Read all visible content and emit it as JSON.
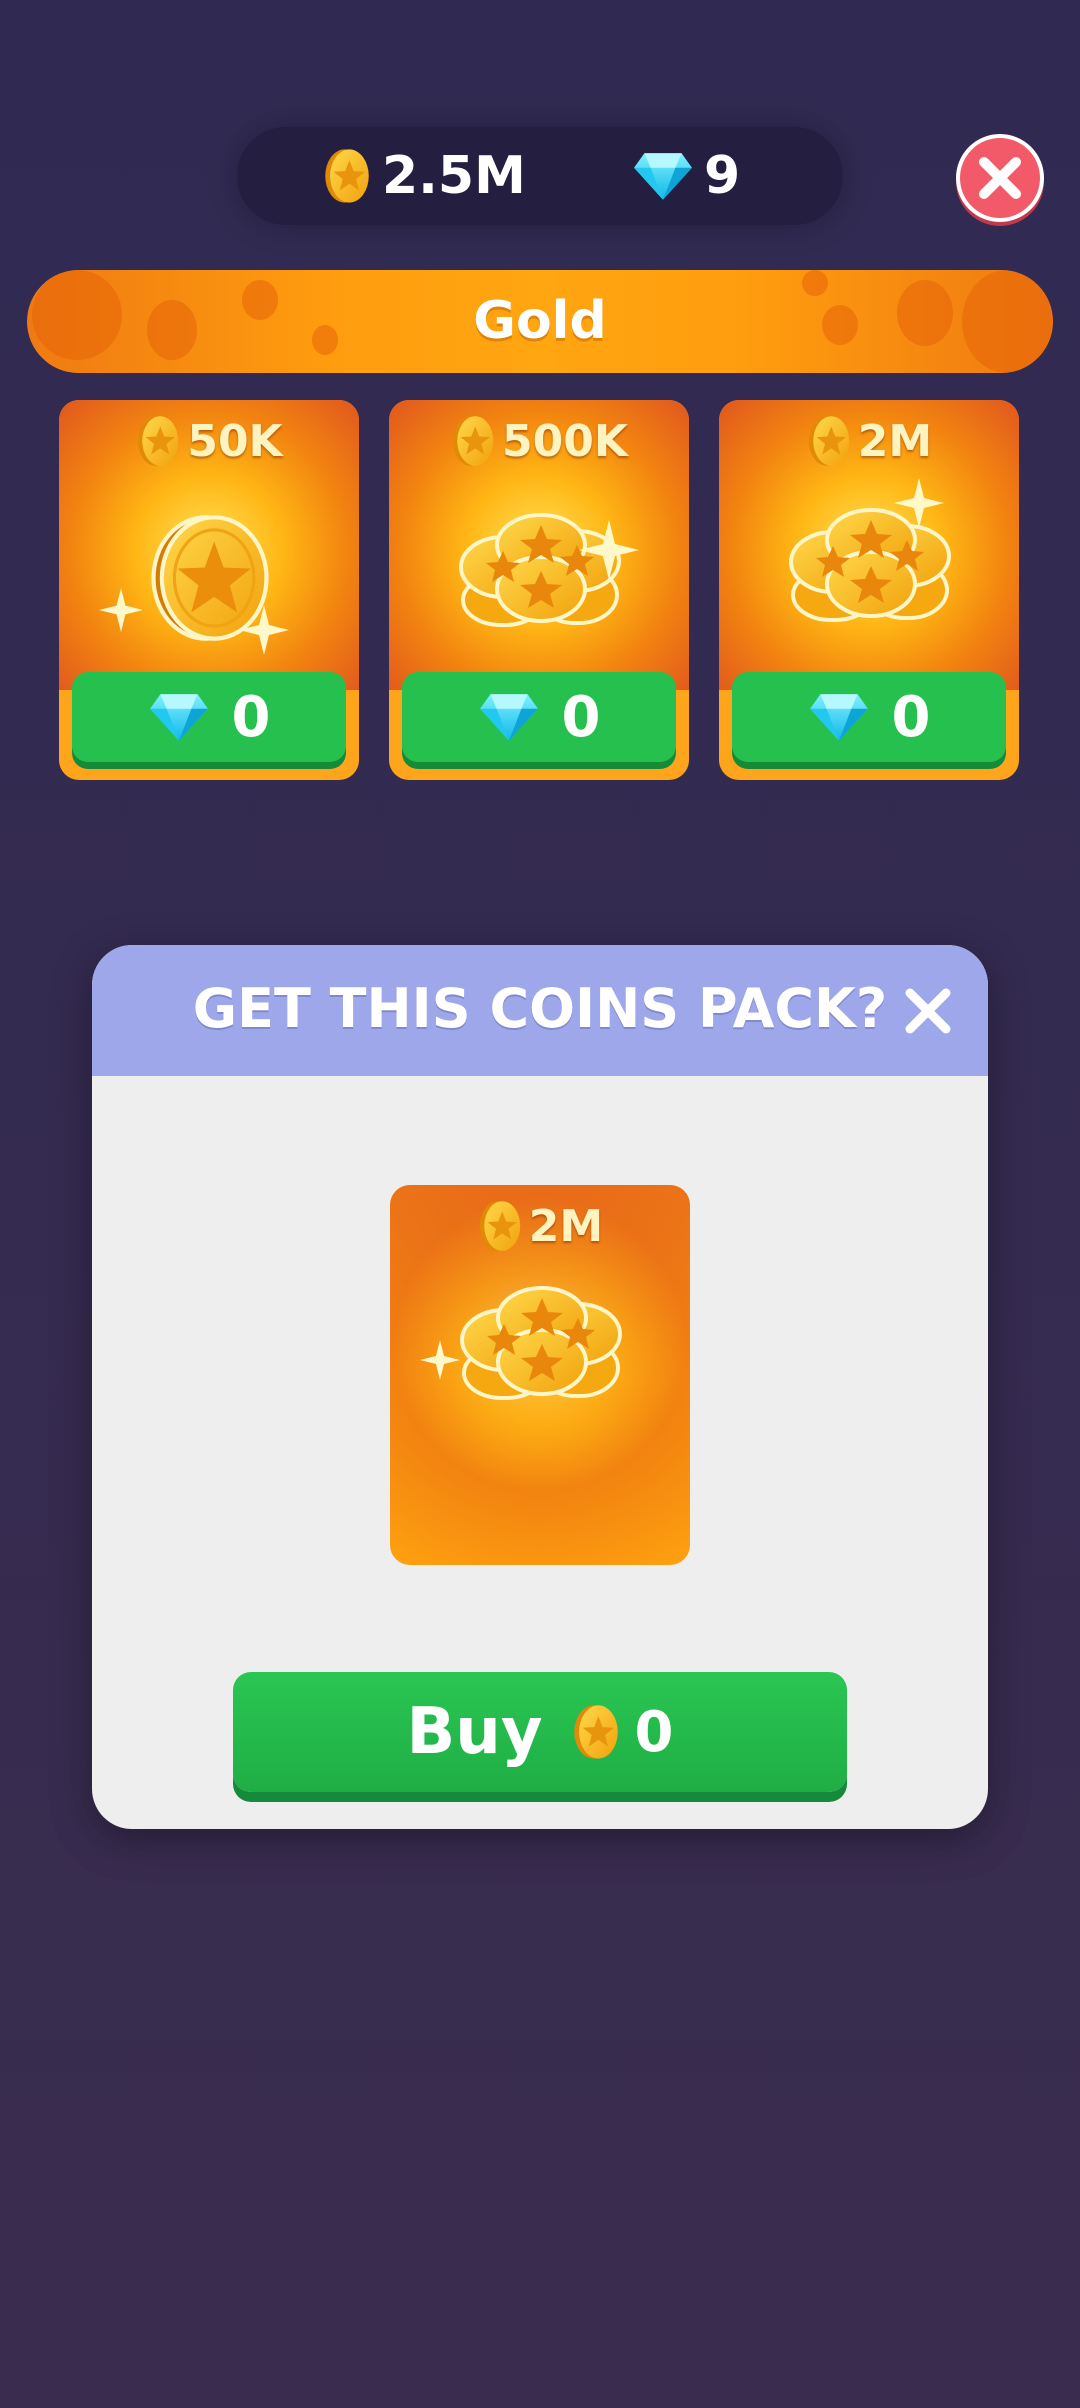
{
  "header": {
    "coins": "2.5M",
    "gems": "9"
  },
  "banner": {
    "title": "Gold"
  },
  "packs": [
    {
      "amount": "50K",
      "price": "0"
    },
    {
      "amount": "500K",
      "price": "0"
    },
    {
      "amount": "2M",
      "price": "0"
    }
  ],
  "modal": {
    "title": "GET THIS COINS PACK?",
    "preview_amount": "2M",
    "buy_label": "Buy",
    "buy_price": "0"
  },
  "colors": {
    "background": "#302a52",
    "accent_orange": "#ff9d0e",
    "button_green": "#26c04f",
    "modal_header": "#9ea7e9",
    "close_red": "#f25a6a"
  },
  "icons": [
    "coin-icon",
    "gem-icon",
    "close-icon",
    "coin-stack-icon"
  ]
}
